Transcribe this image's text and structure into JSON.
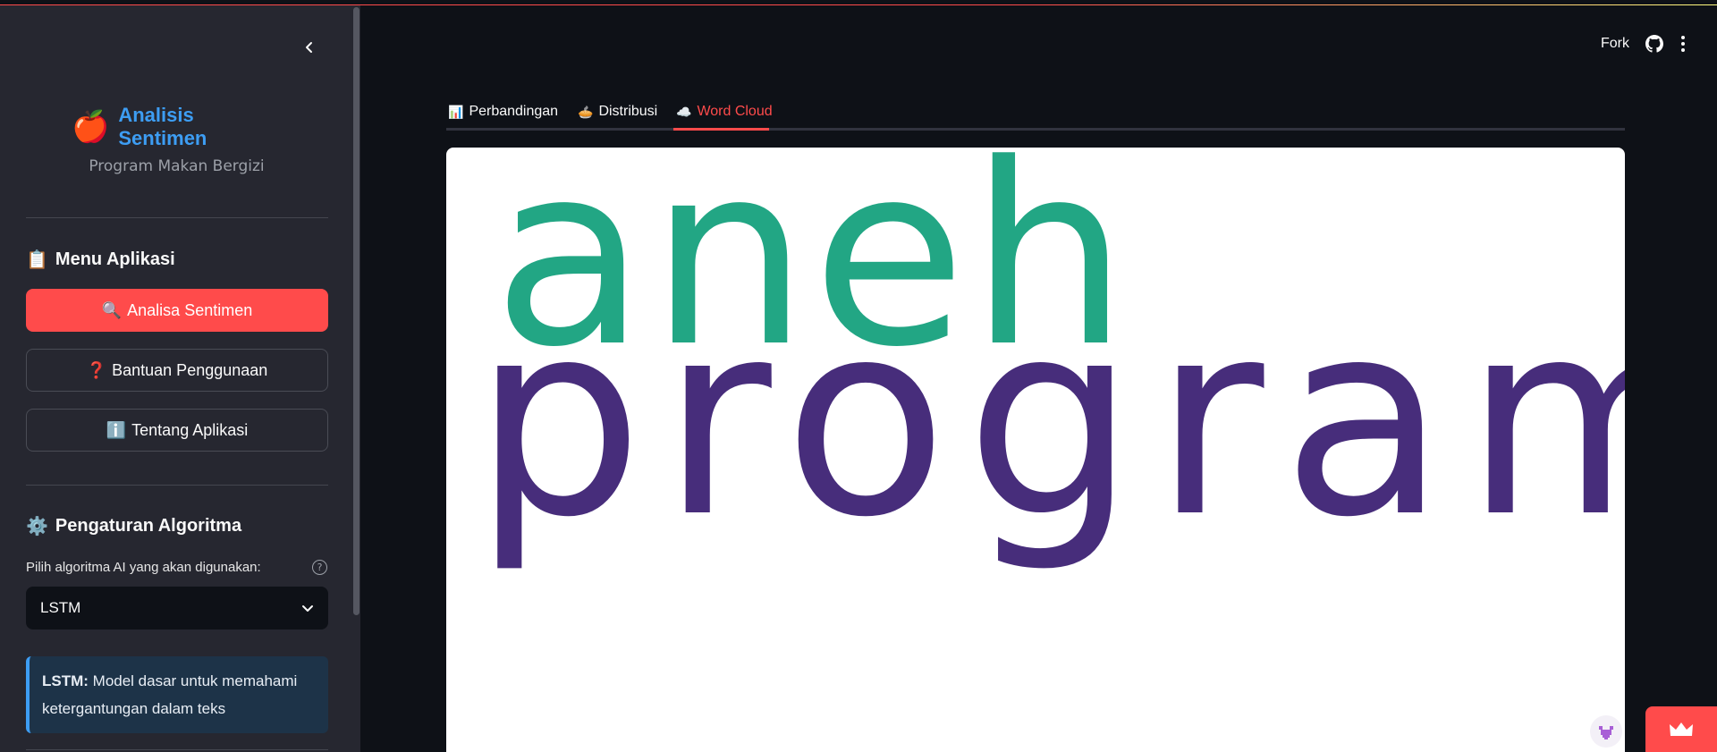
{
  "sidebar": {
    "brand_emoji": "🍎",
    "brand_title": "Analisis Sentimen",
    "brand_subtitle": "Program Makan Bergizi",
    "menu_emoji": "📋",
    "menu_title": "Menu Aplikasi",
    "nav": [
      {
        "emoji": "🔍",
        "label": "Analisa Sentimen",
        "active": true
      },
      {
        "emoji": "❓",
        "label": "Bantuan Penggunaan",
        "active": false
      },
      {
        "emoji": "ℹ️",
        "label": "Tentang Aplikasi",
        "active": false
      }
    ],
    "algo_emoji": "⚙️",
    "algo_title": "Pengaturan Algoritma",
    "select_label": "Pilih algoritma AI yang akan digunakan:",
    "select_value": "LSTM",
    "info_bold": "LSTM:",
    "info_text": " Model dasar untuk memahami ketergantungan dalam teks"
  },
  "header": {
    "fork_label": "Fork",
    "github_icon": "github-icon",
    "menu_icon": "kebab-menu-icon"
  },
  "tabs": [
    {
      "emoji": "📊",
      "label": "Perbandingan",
      "active": false
    },
    {
      "emoji": "🥧",
      "label": "Distribusi",
      "active": false
    },
    {
      "emoji": "☁️",
      "label": "Word Cloud",
      "active": true
    }
  ],
  "wordcloud": {
    "words": [
      {
        "text": "aneh",
        "color": "#22a684"
      },
      {
        "text": "program",
        "color": "#472d7b"
      }
    ]
  },
  "colors": {
    "accent": "#ff4b4b",
    "link": "#3d9df3",
    "background": "#0e1117",
    "sidebar": "#262730"
  }
}
